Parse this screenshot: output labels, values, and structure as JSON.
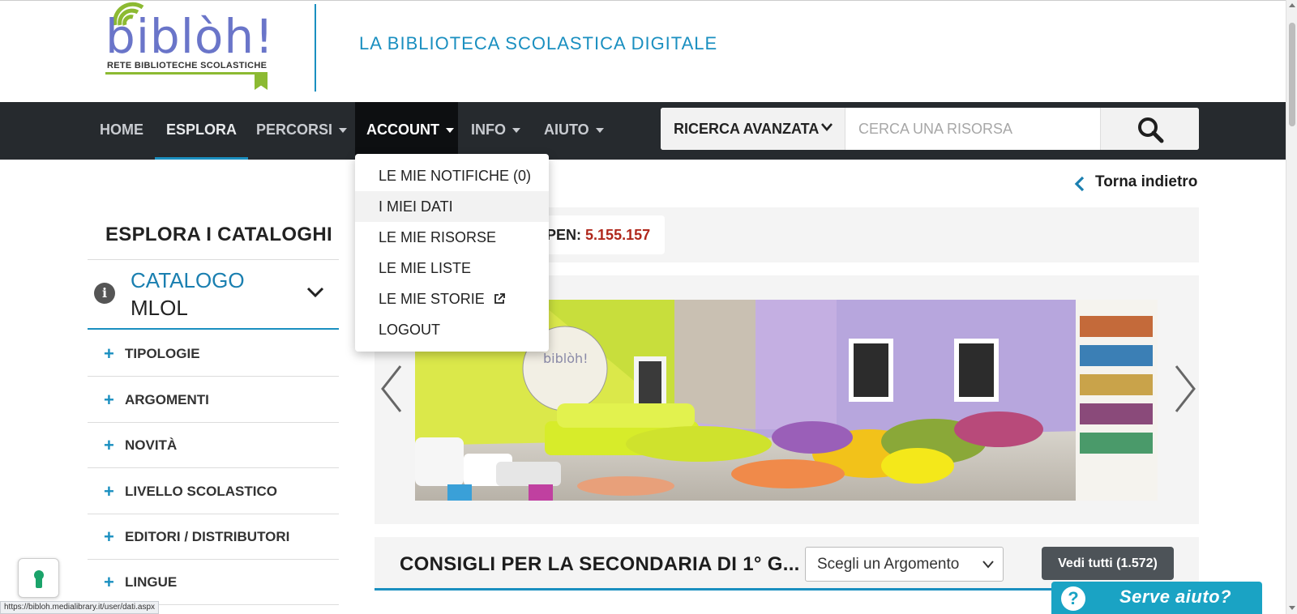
{
  "header": {
    "logo_text": "biblòh!",
    "logo_tagline": "RETE BIBLIOTECHE SCOLASTICHE",
    "title": "LA BIBLIOTECA SCOLASTICA DIGITALE"
  },
  "nav": {
    "items": [
      {
        "label": "HOME"
      },
      {
        "label": "ESPLORA"
      },
      {
        "label": "PERCORSI"
      },
      {
        "label": "ACCOUNT"
      },
      {
        "label": "INFO"
      },
      {
        "label": "AIUTO"
      }
    ],
    "active": "ESPLORA",
    "open_menu": "ACCOUNT"
  },
  "search": {
    "advanced_label": "RICERCA AVANZATA",
    "placeholder": "CERCA UNA RISORSA",
    "value": ""
  },
  "account_menu": {
    "items": [
      {
        "label": "LE MIE NOTIFICHE (0)"
      },
      {
        "label": "I MIEI DATI"
      },
      {
        "label": "LE MIE RISORSE"
      },
      {
        "label": "LE MIE LISTE"
      },
      {
        "label": "LE MIE STORIE"
      },
      {
        "label": "LOGOUT"
      }
    ],
    "hovered": "I MIEI DATI"
  },
  "back_link": "Torna indietro",
  "sidebar": {
    "title": "ESPLORA I CATALOGHI",
    "catalog_label": "CATALOGO",
    "catalog_value": "MLOL",
    "items": [
      {
        "label": "TIPOLOGIE"
      },
      {
        "label": "ARGOMENTI"
      },
      {
        "label": "NOVITÀ"
      },
      {
        "label": "LIVELLO SCOLASTICO"
      },
      {
        "label": "EDITORI / DISTRIBUTORI"
      },
      {
        "label": "LINGUE"
      }
    ]
  },
  "stats": {
    "label_partial": "PEN:",
    "value": "5.155.157"
  },
  "consigli": {
    "title": "CONSIGLI PER LA SECONDARIA DI 1° G...",
    "select_value": "Scegli un Argomento",
    "button_label": "Vedi tutti (1.572)"
  },
  "help_widget": {
    "label": "Serve aiuto?"
  },
  "status_bar": {
    "url": "https://bibloh.medialibrary.it/user/dati.aspx"
  },
  "colors": {
    "accent": "#1a8fc0",
    "navbar": "#262a2e",
    "count_value": "#b0281c",
    "help_widget": "#1aa3c4"
  }
}
